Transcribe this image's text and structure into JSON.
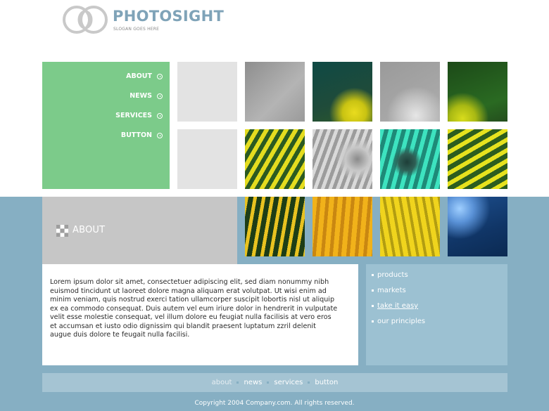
{
  "brand": {
    "title": "PHOTOSIGHT",
    "slogan": "SLOGAN GOES HERE"
  },
  "nav": {
    "items": [
      {
        "label": "ABOUT"
      },
      {
        "label": "NEWS"
      },
      {
        "label": "SERVICES"
      },
      {
        "label": "BUTTON"
      }
    ]
  },
  "section": {
    "title": "ABOUT"
  },
  "content": {
    "body": "Lorem ipsum dolor sit amet, consectetuer adipiscing elit, sed diam nonummy nibh euismod tincidunt ut laoreet dolore magna aliquam erat volutpat. Ut wisi enim ad minim veniam, quis nostrud exerci tation ullamcorper suscipit lobortis nisl ut aliquip ex ea commodo consequat. Duis autem vel eum iriure dolor in hendrerit in vulputate velit esse molestie consequat, vel illum dolore eu feugiat nulla facilisis at vero eros et accumsan et iusto odio dignissim qui blandit praesent luptatum zzril delenit augue duis dolore te feugait nulla facilisi."
  },
  "sidebar": {
    "links": [
      {
        "label": "products"
      },
      {
        "label": "markets"
      },
      {
        "label": "take it easy"
      },
      {
        "label": "our principles"
      }
    ]
  },
  "footer": {
    "links": [
      {
        "label": "about"
      },
      {
        "label": "news"
      },
      {
        "label": "services"
      },
      {
        "label": "button"
      }
    ],
    "copyright": "Copyright 2004 Company.com. All rights reserved."
  },
  "colors": {
    "nav_green": "#7ccb8a",
    "band_blue": "#86afc3",
    "brand_blue": "#7fa3b8"
  }
}
